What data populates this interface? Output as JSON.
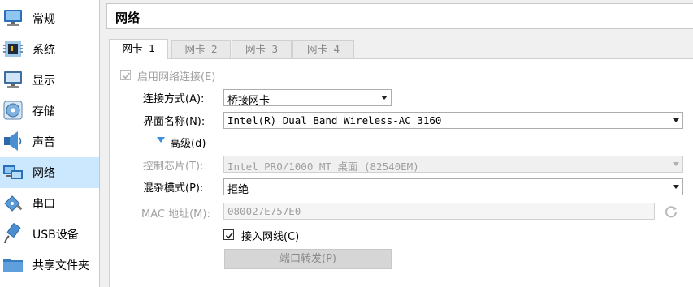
{
  "sidebar": {
    "items": [
      {
        "label": "常规",
        "icon": "general-monitor-icon"
      },
      {
        "label": "系统",
        "icon": "system-chip-icon"
      },
      {
        "label": "显示",
        "icon": "display-monitor-icon"
      },
      {
        "label": "存储",
        "icon": "storage-disc-icon"
      },
      {
        "label": "声音",
        "icon": "audio-speaker-icon"
      },
      {
        "label": "网络",
        "icon": "network-icon",
        "active": true
      },
      {
        "label": "串口",
        "icon": "serial-port-icon"
      },
      {
        "label": "USB设备",
        "icon": "usb-icon"
      },
      {
        "label": "共享文件夹",
        "icon": "shared-folder-icon"
      }
    ]
  },
  "header": {
    "title": "网络"
  },
  "tabs": [
    {
      "label": "网卡 1",
      "active": true
    },
    {
      "label": "网卡 2"
    },
    {
      "label": "网卡 3"
    },
    {
      "label": "网卡 4"
    }
  ],
  "adapter": {
    "enable_label": "启用网络连接(E)",
    "enabled": true,
    "attached_to_label": "连接方式(A):",
    "attached_to_value": "桥接网卡",
    "name_label": "界面名称(N):",
    "name_value": "Intel(R) Dual Band Wireless-AC 3160",
    "advanced_label": "高级(d)",
    "adapter_type_label": "控制芯片(T):",
    "adapter_type_value": "Intel PRO/1000 MT 桌面 (82540EM)",
    "promiscuous_label": "混杂模式(P):",
    "promiscuous_value": "拒绝",
    "mac_label": "MAC 地址(M):",
    "mac_value": "080027E757E0",
    "cable_label": "接入网线(C)",
    "cable_connected": true,
    "port_forwarding_label": "端口转发(P)"
  },
  "colors": {
    "selected_item_bg": "#cce8ff",
    "disabled_text": "#a0a0a0",
    "accent_blue": "#3c8fd8"
  }
}
